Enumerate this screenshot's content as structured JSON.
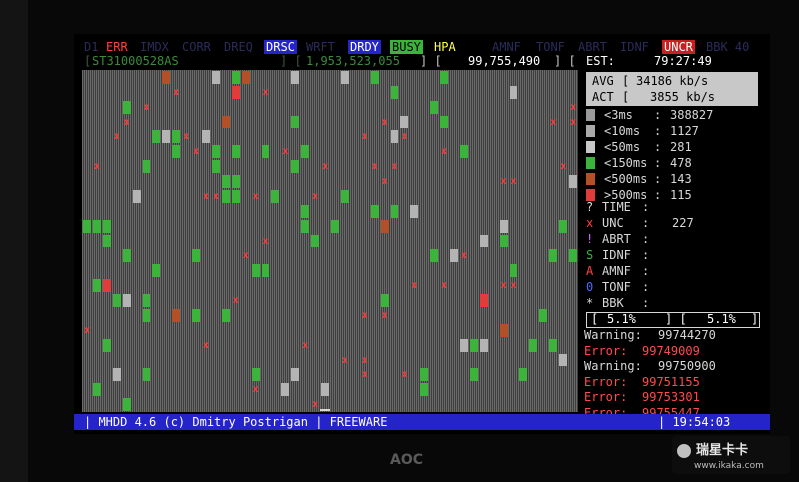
{
  "header_flags": [
    {
      "label": "ERR",
      "fg": "#ff4040",
      "bg": "#000"
    },
    {
      "label": "DRSC",
      "fg": "#ffffff",
      "bg": "#2424c8"
    },
    {
      "label": "DRDY",
      "fg": "#ffffff",
      "bg": "#2424c8"
    },
    {
      "label": "BUSY",
      "fg": "#000000",
      "bg": "#3cb43c"
    },
    {
      "label": "HPA",
      "fg": "#ffff50",
      "bg": "#000"
    },
    {
      "label": "UNCR",
      "fg": "#ffffff",
      "bg": "#c82020"
    }
  ],
  "header_dim": [
    "D1",
    "IMDX",
    "CORR",
    "DREQ",
    "WRFT",
    "AMNF",
    "TONF",
    "ABRT",
    "IDNF",
    "BBK 40"
  ],
  "drive": {
    "model": "ST31000528AS",
    "capacity": "1,953,523,055",
    "current_lba": "99,755,490"
  },
  "est": {
    "label": "EST:",
    "value": "79:27:49"
  },
  "speed": {
    "avg_label": "AVG",
    "avg_value": "34186 kb/s",
    "act_label": "ACT",
    "act_value": "3855 kb/s"
  },
  "timings": [
    {
      "label": "<3ms",
      "value": "388827",
      "color": "#9a9a9a"
    },
    {
      "label": "<10ms",
      "value": "1127",
      "color": "#aaaaaa"
    },
    {
      "label": "<50ms",
      "value": "281",
      "color": "#c8c8c8"
    },
    {
      "label": "<150ms",
      "value": "478",
      "color": "#3cb43c"
    },
    {
      "label": "<500ms",
      "value": "143",
      "color": "#b45028"
    },
    {
      "label": ">500ms",
      "value": "115",
      "color": "#e03c3c"
    }
  ],
  "errors_legend": [
    {
      "sym": "?",
      "label": "TIME",
      "value": "",
      "color": "#d8d8d8"
    },
    {
      "sym": "x",
      "label": "UNC",
      "value": "227",
      "color": "#ff4040"
    },
    {
      "sym": "!",
      "label": "ABRT",
      "value": "",
      "color": "#c864ff"
    },
    {
      "sym": "S",
      "label": "IDNF",
      "value": "",
      "color": "#3cb43c"
    },
    {
      "sym": "A",
      "label": "AMNF",
      "value": "",
      "color": "#ff4040"
    },
    {
      "sym": "0",
      "label": "TONF",
      "value": "",
      "color": "#4a6aff"
    },
    {
      "sym": "*",
      "label": "BBK",
      "value": "",
      "color": "#d8d8d8"
    }
  ],
  "progress": {
    "left": "5.1%",
    "right": "5.1%"
  },
  "log": [
    {
      "type": "Warning:",
      "value": "99744270",
      "kind": "warn"
    },
    {
      "type": "Error:",
      "value": "99749009",
      "kind": "err"
    },
    {
      "type": "Warning:",
      "value": "99750900",
      "kind": "warn"
    },
    {
      "type": "Error:",
      "value": "99751155",
      "kind": "err"
    },
    {
      "type": "Error:",
      "value": "99753301",
      "kind": "err"
    },
    {
      "type": "Error:",
      "value": "99755447",
      "kind": "err"
    }
  ],
  "statusbar": {
    "title": "| MHDD 4.6 (c) Dmitry Postrigan | FREEWARE",
    "clock": "| 19:54:03"
  },
  "monitor_logo": "AOC",
  "watermark": {
    "title": "瑞星卡卡",
    "url": "www.ikaka.com"
  }
}
